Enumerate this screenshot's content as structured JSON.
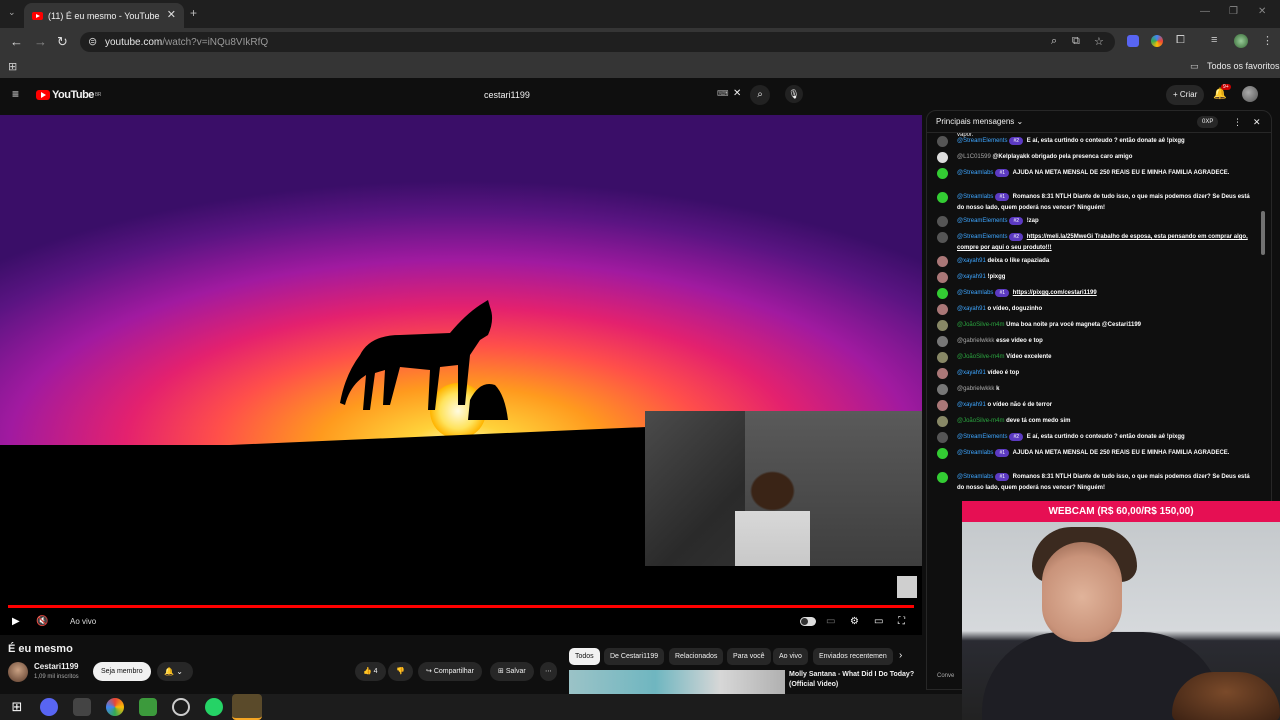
{
  "browser": {
    "tab_title": "(11) É eu mesmo - YouTube",
    "url_host": "youtube.com",
    "url_path": "/watch?v=iNQu8VIkRfQ",
    "bookmarks_label": "Todos os favoritos"
  },
  "youtube": {
    "logo": "YouTube",
    "region": "BR",
    "search_query": "cestari1199",
    "create_label": "Criar",
    "notif_count": "9+"
  },
  "player": {
    "live_label": "Ao vivo",
    "progress": 1.0
  },
  "video": {
    "title": "É eu mesmo",
    "channel": "Cestari1199",
    "subscribers": "1,09 mil inscritos",
    "member_button": "Seja membro",
    "likes": "4",
    "share": "Compartilhar",
    "save": "Salvar"
  },
  "chips": [
    "Todos",
    "De Cestari1199",
    "Relacionados",
    "Para você",
    "Ao vivo",
    "Enviados recentemen"
  ],
  "related": {
    "title": "Molly Santana - What Did I Do Today? (Official Video)"
  },
  "chat": {
    "header": "Principais mensagens",
    "xp": "0XP",
    "top_fragment": "vapor.",
    "messages": [
      {
        "author": "@StreamElements",
        "badge": "#2",
        "text": "E aí, esta curtindo o conteudo ? então donate aê !pixgg",
        "color": "#3ea6ff"
      },
      {
        "author": "@L1C01599",
        "badge": "",
        "text": "@Kelplayakk obrigado pela presenca caro amigo",
        "color": "#aaaaaa"
      },
      {
        "author": "@Streamlabs",
        "badge": "#1",
        "text": "AJUDA NA META MENSAL DE 250 REAIS EU E MINHA FAMILIA AGRADECE.",
        "color": "#3ea6ff"
      },
      {
        "author": "@Streamlabs",
        "badge": "#1",
        "text": "Romanos 8:31 NTLH Diante de tudo isso, o que mais podemos dizer? Se Deus está do nosso lado, quem poderá nos vencer? Ninguém!",
        "color": "#3ea6ff"
      },
      {
        "author": "@StreamElements",
        "badge": "#2",
        "text": "!zap",
        "color": "#3ea6ff"
      },
      {
        "author": "@StreamElements",
        "badge": "#2",
        "text": "https://meli.la/25MweGi Trabalho de esposa, esta pensando em comprar algo, compre por aqui o seu produto!!!",
        "color": "#3ea6ff"
      },
      {
        "author": "@xayah91",
        "badge": "",
        "text": "deixa o like rapaziada",
        "color": "#3ea6ff"
      },
      {
        "author": "@xayah91",
        "badge": "",
        "text": "!pixgg",
        "color": "#3ea6ff"
      },
      {
        "author": "@Streamlabs",
        "badge": "#1",
        "text": "https://pixgg.com/cestari1199",
        "color": "#3ea6ff"
      },
      {
        "author": "@xayah91",
        "badge": "",
        "text": "o vídeo, doguzinho",
        "color": "#3ea6ff"
      },
      {
        "author": "@JoãoSilve-m4m",
        "badge": "",
        "text": "Uma boa noite pra você magneta @Cestari1199",
        "color": "#2ba640"
      },
      {
        "author": "@gabrielwkkk",
        "badge": "",
        "text": "esse video e top",
        "color": "#aaaaaa"
      },
      {
        "author": "@JoãoSilve-m4m",
        "badge": "",
        "text": "Vídeo excelente",
        "color": "#2ba640"
      },
      {
        "author": "@xayah91",
        "badge": "",
        "text": "vídeo é top",
        "color": "#3ea6ff"
      },
      {
        "author": "@gabrielwkkk",
        "badge": "",
        "text": "k",
        "color": "#aaaaaa"
      },
      {
        "author": "@xayah91",
        "badge": "",
        "text": "o vídeo não é de terror",
        "color": "#3ea6ff"
      },
      {
        "author": "@JoãoSilve-m4m",
        "badge": "",
        "text": "deve tá com medo sim",
        "color": "#2ba640"
      },
      {
        "author": "@StreamElements",
        "badge": "#2",
        "text": "E aí, esta curtindo o conteudo ? então donate aê !pixgg",
        "color": "#3ea6ff"
      },
      {
        "author": "@Streamlabs",
        "badge": "#1",
        "text": "AJUDA NA META MENSAL DE 250 REAIS EU E MINHA FAMILIA AGRADECE.",
        "color": "#3ea6ff"
      },
      {
        "author": "@Streamlabs",
        "badge": "#1",
        "text": "Romanos 8:31 NTLH Diante de tudo isso, o que mais podemos dizer? Se Deus está do nosso lado, quem poderá nos vencer? Ninguém!",
        "color": "#3ea6ff"
      }
    ],
    "footer": "Conve"
  },
  "overlay": {
    "webcam_label": "WEBCAM (R$ 60,00/R$ 150,00)"
  },
  "colors": {
    "accent_red": "#ff0000",
    "webcam_label_bg": "#e60f53",
    "badge_purple": "#5c3ac2"
  }
}
